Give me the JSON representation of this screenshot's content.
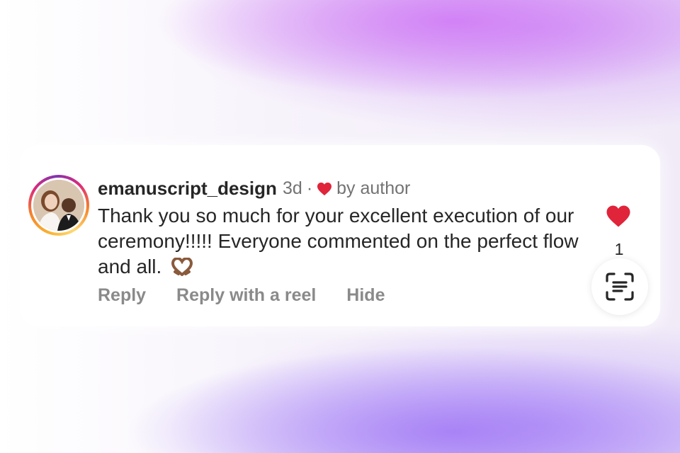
{
  "comment": {
    "username": "emanuscript_design",
    "time": "3d",
    "separator": "·",
    "liked_by_author": "by author",
    "text": "Thank you so much for your excellent execution of our ceremony!!!!! Everyone commented on the perfect flow and all.",
    "text_emoji": "heart-hands-emoji",
    "like_count": "1"
  },
  "actions": {
    "reply": "Reply",
    "reply_with_reel": "Reply with a reel",
    "hide": "Hide"
  },
  "icons": {
    "like": "heart-icon",
    "author_like": "heart-icon",
    "scan": "text-scan-icon"
  },
  "colors": {
    "heart_red": "#e0243a",
    "text_primary": "#262626",
    "text_secondary": "#737373",
    "action_gray": "#8a8a8a"
  }
}
